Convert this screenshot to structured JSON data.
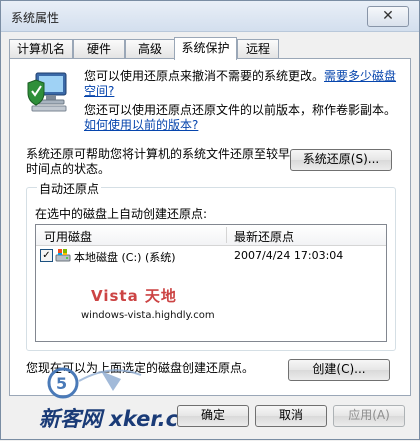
{
  "window": {
    "title": "系统属性",
    "close_glyph": "✕"
  },
  "tabs": [
    {
      "label": "计算机名"
    },
    {
      "label": "硬件"
    },
    {
      "label": "高级"
    },
    {
      "label": "系统保护",
      "active": true
    },
    {
      "label": "远程"
    }
  ],
  "protection": {
    "intro_text": "您可以使用还原点来撤消不需要的系统更改。",
    "intro_link": "需要多少磁盘空间?",
    "previous_text": "您还可以使用还原点还原文件的以前版本，称作卷影副本。",
    "previous_link": "如何使用以前的版本?",
    "restore_desc": "系统还原可帮助您将计算机的系统文件还原至较早时间点的状态。",
    "restore_button": "系统还原(S)...",
    "group_label": "自动还原点",
    "group_desc": "在选中的磁盘上自动创建还原点:",
    "columns": [
      "可用磁盘",
      "最新还原点"
    ],
    "disks": [
      {
        "name": "本地磁盘 (C:) (系统)",
        "latest": "2007/4/24 17:03:04",
        "checked": true
      }
    ],
    "watermark_title": "Vista 天地",
    "watermark_url": "windows-vista.highdly.com",
    "create_desc": "您现在可以为上面选定的磁盘创建还原点。",
    "create_button": "创建(C)..."
  },
  "footer": {
    "ok_button": "确定",
    "cancel_button": "取消",
    "apply_button": "应用(A)",
    "watermark_text": "新客网 xker.com"
  }
}
